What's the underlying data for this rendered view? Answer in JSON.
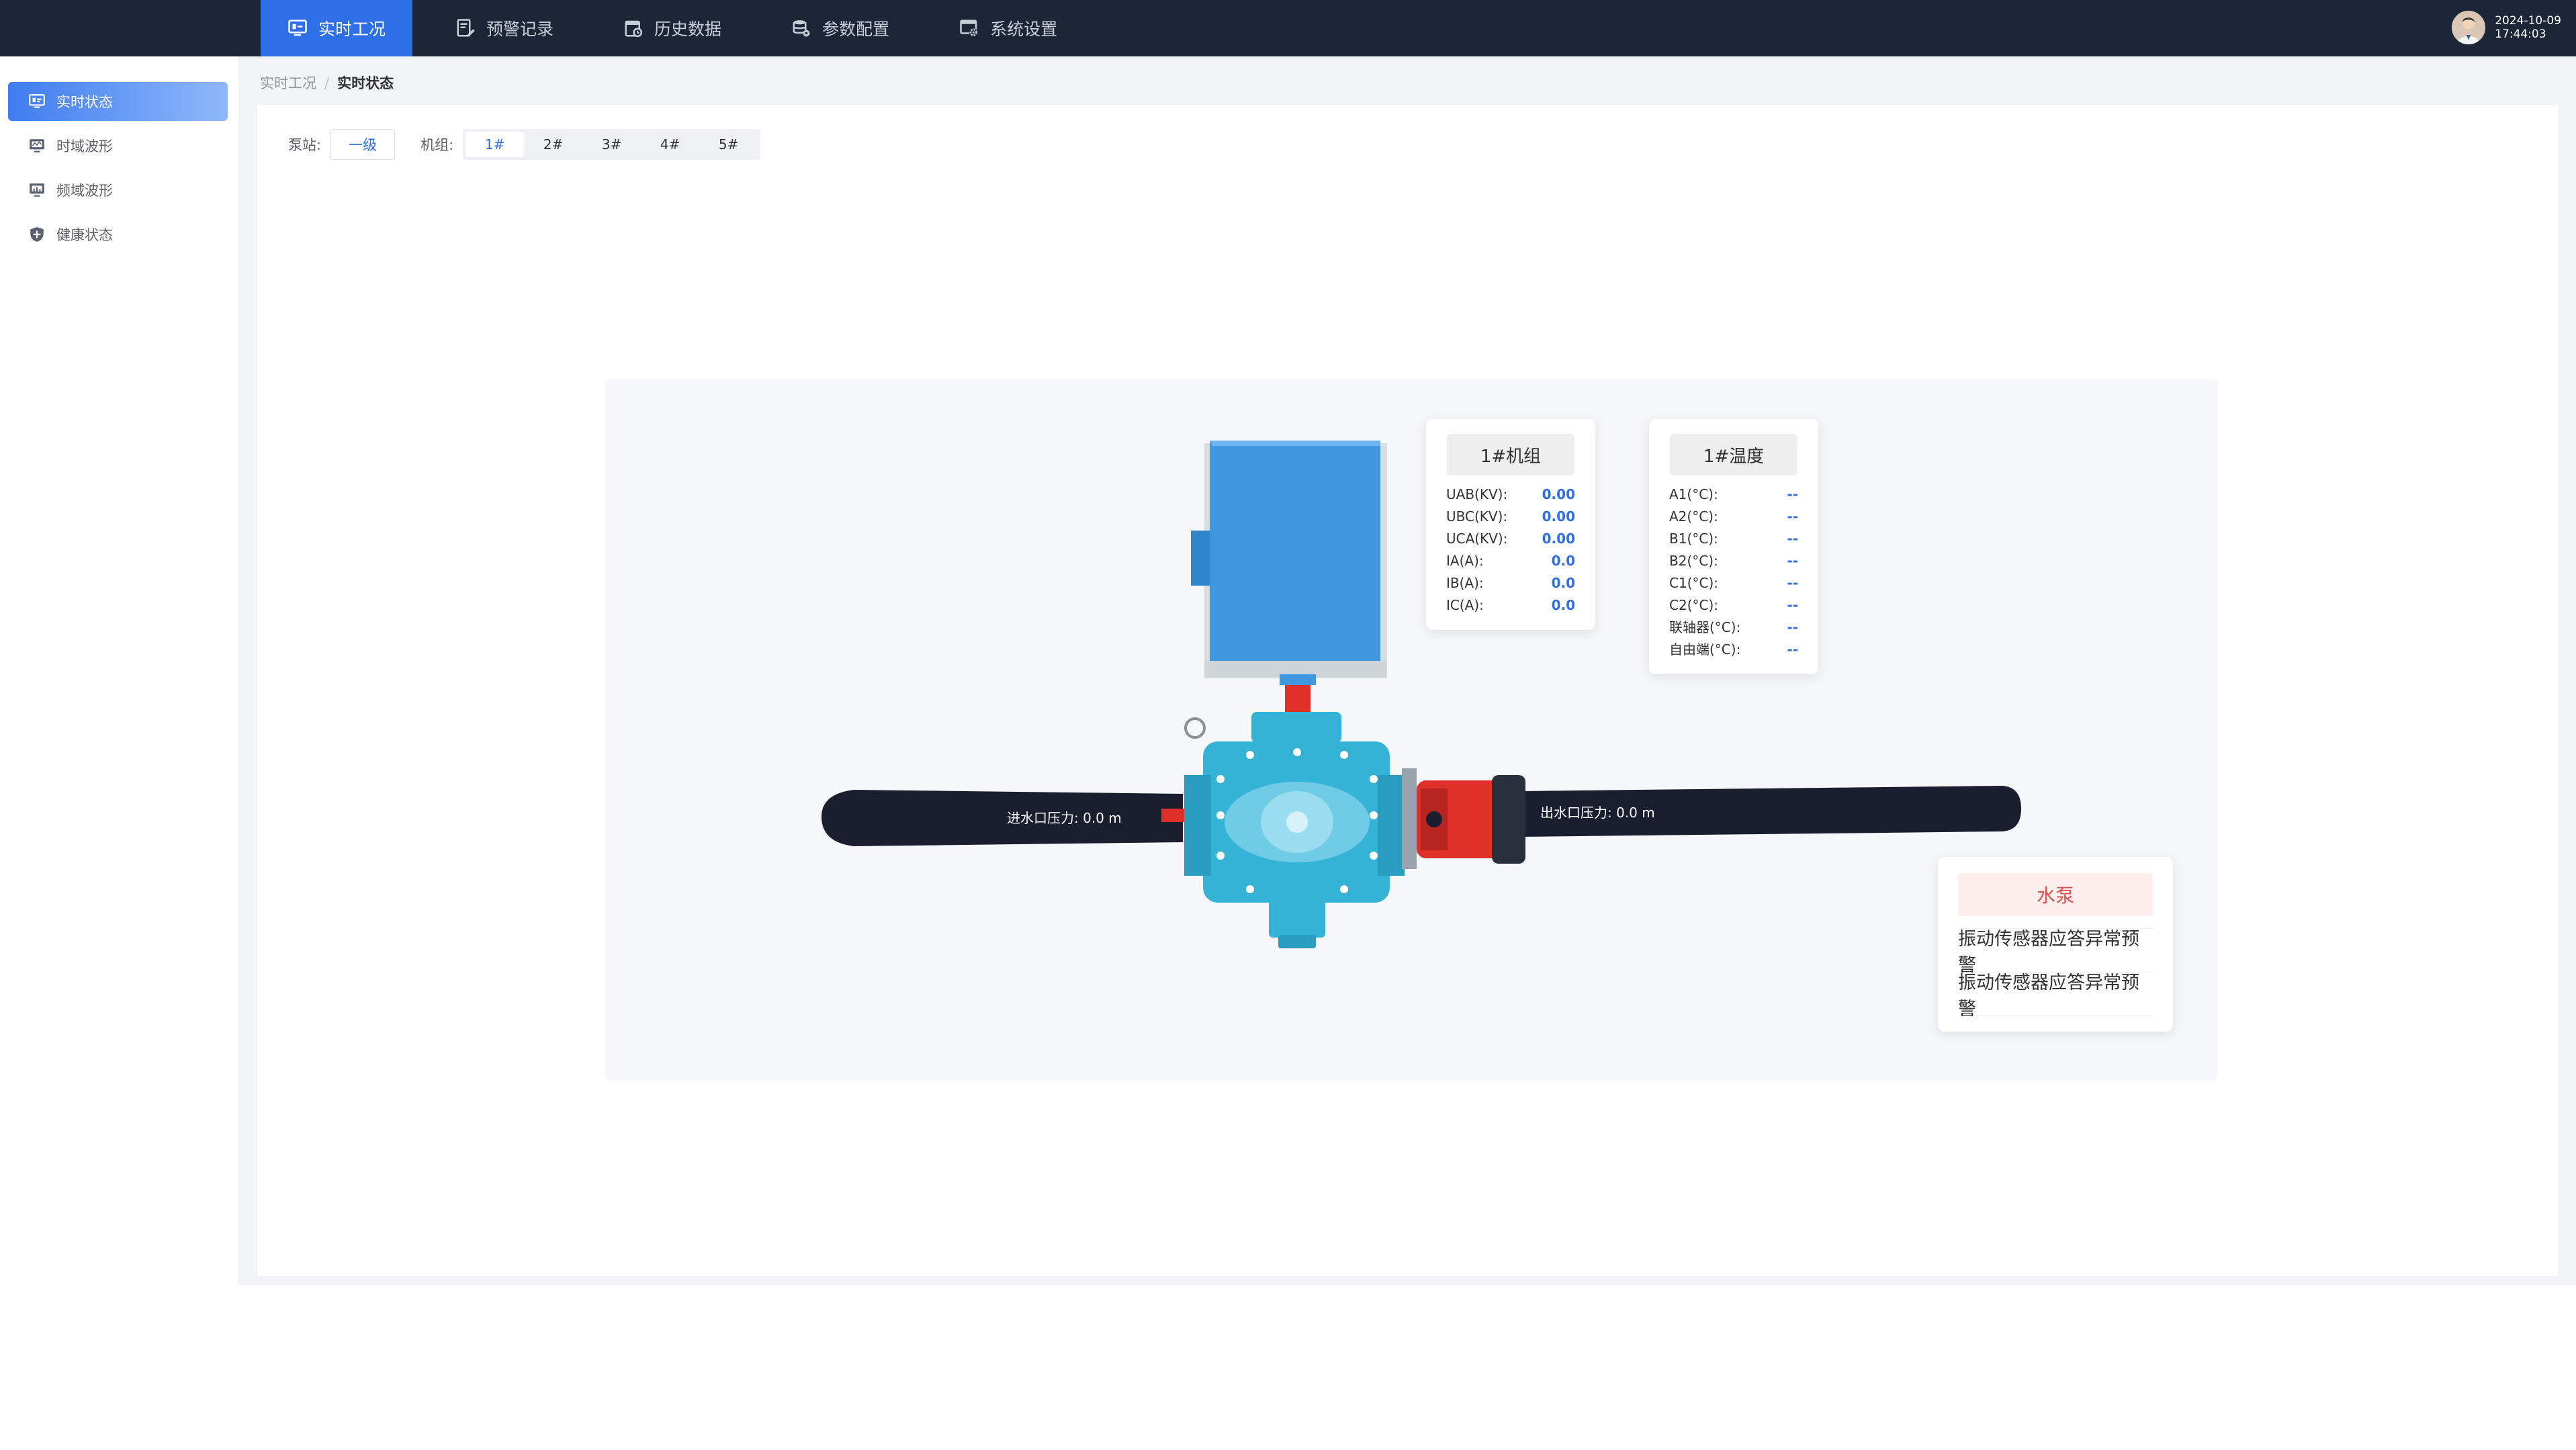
{
  "nav": {
    "items": [
      {
        "label": "实时工况",
        "icon": "monitor-icon",
        "active": true
      },
      {
        "label": "预警记录",
        "icon": "edit-list-icon",
        "active": false
      },
      {
        "label": "历史数据",
        "icon": "calendar-icon",
        "active": false
      },
      {
        "label": "参数配置",
        "icon": "database-config-icon",
        "active": false
      },
      {
        "label": "系统设置",
        "icon": "settings-icon",
        "active": false
      }
    ]
  },
  "user": {
    "date": "2024-10-09",
    "time": "17:44:03"
  },
  "sidebar": {
    "items": [
      {
        "label": "实时状态",
        "icon": "dashboard-icon",
        "active": true
      },
      {
        "label": "时域波形",
        "icon": "screen-icon",
        "active": false
      },
      {
        "label": "频域波形",
        "icon": "screen-icon",
        "active": false
      },
      {
        "label": "健康状态",
        "icon": "shield-plus-icon",
        "active": false
      }
    ]
  },
  "breadcrumb": {
    "parent": "实时工况",
    "separator": "/",
    "current": "实时状态"
  },
  "filter": {
    "station_label": "泵站:",
    "station_value": "一级",
    "unit_label": "机组:",
    "units": [
      "1#",
      "2#",
      "3#",
      "4#",
      "5#"
    ],
    "active_unit": "1#"
  },
  "unit_card": {
    "title": "1#机组",
    "rows": [
      {
        "label": "UAB(KV):",
        "value": "0.00"
      },
      {
        "label": "UBC(KV):",
        "value": "0.00"
      },
      {
        "label": "UCA(KV):",
        "value": "0.00"
      },
      {
        "label": "IA(A):",
        "value": "0.0"
      },
      {
        "label": "IB(A):",
        "value": "0.0"
      },
      {
        "label": "IC(A):",
        "value": "0.0"
      }
    ]
  },
  "temp_card": {
    "title": "1#温度",
    "rows": [
      {
        "label": "A1(°C):",
        "value": "--"
      },
      {
        "label": "A2(°C):",
        "value": "--"
      },
      {
        "label": "B1(°C):",
        "value": "--"
      },
      {
        "label": "B2(°C):",
        "value": "--"
      },
      {
        "label": "C1(°C):",
        "value": "--"
      },
      {
        "label": "C2(°C):",
        "value": "--"
      },
      {
        "label": "联轴器(°C):",
        "value": "--"
      },
      {
        "label": "自由端(°C):",
        "value": "--"
      }
    ]
  },
  "pressure": {
    "inlet": "进水口压力:  0.0 m",
    "outlet": "出水口压力:  0.0 m"
  },
  "alarm_card": {
    "title": "水泵",
    "items": [
      "振动传感器应答异常预警",
      "振动传感器应答异常预警"
    ]
  },
  "colors": {
    "topbar": "#1c2637",
    "accent": "#2e6ee6",
    "pipe": "#1a1e2e",
    "pump_body": "#35b3d6",
    "motor": "#3f97e0",
    "coupling_red": "#e0302a"
  }
}
